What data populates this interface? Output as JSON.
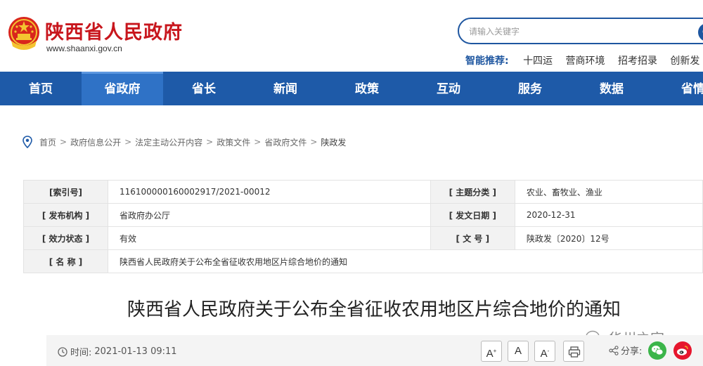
{
  "header": {
    "site_name": "陕西省人民政府",
    "site_url": "www.shaanxi.gov.cn",
    "search": {
      "placeholder": "请输入关键字"
    },
    "hot": {
      "label": "智能推荐:",
      "items": [
        "十四运",
        "营商环境",
        "招考招录",
        "创新发"
      ]
    }
  },
  "nav": {
    "items": [
      {
        "label": "首页"
      },
      {
        "label": "省政府"
      },
      {
        "label": "省长"
      },
      {
        "label": "新闻"
      },
      {
        "label": "政策"
      },
      {
        "label": "互动"
      },
      {
        "label": "服务"
      },
      {
        "label": "数据"
      },
      {
        "label": "省情"
      }
    ],
    "active_index": 1
  },
  "breadcrumb": {
    "items": [
      "首页",
      "政府信息公开",
      "法定主动公开内容",
      "政策文件",
      "省政府文件",
      "陕政发"
    ],
    "separator": ">"
  },
  "info": {
    "index_label": "[索引号]",
    "index_value": "116100000160002917/2021-00012",
    "topic_label": "[ 主题分类 ]",
    "topic_value": "农业、畜牧业、渔业",
    "issuer_label": "[ 发布机构 ]",
    "issuer_value": "省政府办公厅",
    "date_label": "[ 发文日期 ]",
    "date_value": "2020-12-31",
    "status_label": "[ 效力状态 ]",
    "status_value": "有效",
    "docno_label": "[ 文  号 ]",
    "docno_value": "陕政发〔2020〕12号",
    "name_label": "[ 名  称 ]",
    "name_value": "陕西省人民政府关于公布全省征收农用地区片综合地价的通知"
  },
  "document": {
    "title": "陕西省人民政府关于公布全省征收农用地区片综合地价的通知"
  },
  "watermark": {
    "text": "华州之家"
  },
  "toolbar": {
    "time_label": "时间:",
    "time_value": "2021-01-13 09:11",
    "font_large": "A",
    "font_normal": "A",
    "font_small": "A",
    "share_label": "分享:"
  },
  "colors": {
    "brand_red": "#c8161d",
    "nav_blue": "#1e5aa8",
    "nav_active": "#2f72c6"
  }
}
